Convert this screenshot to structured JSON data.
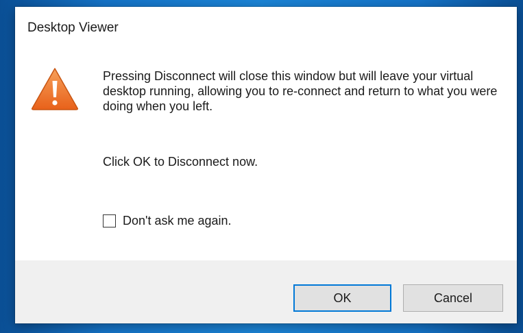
{
  "dialog": {
    "title": "Desktop Viewer",
    "icon": "warning-icon",
    "message": "Pressing Disconnect will close this window but will leave your virtual desktop running, allowing you to re-connect and return to what you were doing when you left.",
    "instruction": "Click OK to Disconnect now.",
    "checkbox": {
      "label": "Don't ask me again.",
      "checked": false
    },
    "buttons": {
      "ok_label": "OK",
      "cancel_label": "Cancel"
    }
  },
  "colors": {
    "dialog_bg": "#ffffff",
    "footer_bg": "#f0f0f0",
    "default_button_border": "#0078d7",
    "warning_orange": "#f07b2a",
    "desktop_blue": "#1573c7"
  }
}
